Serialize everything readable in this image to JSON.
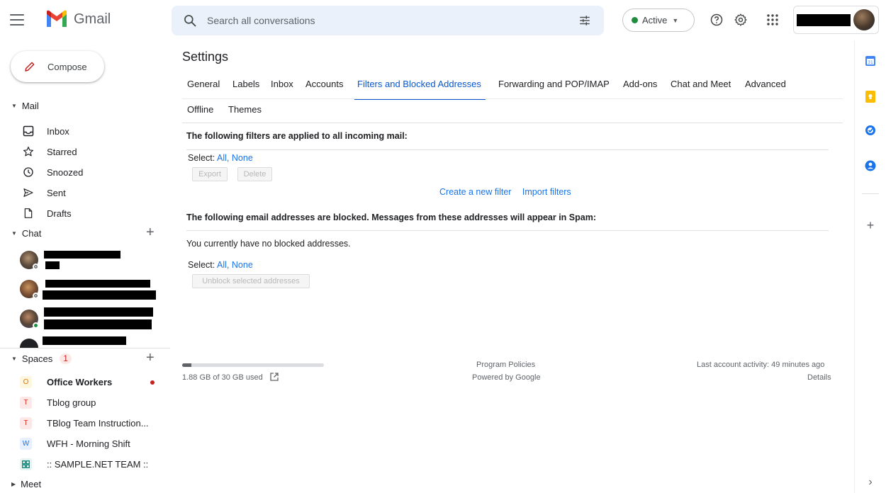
{
  "app": {
    "name": "Gmail"
  },
  "search": {
    "placeholder": "Search all conversations"
  },
  "status": {
    "label": "Active",
    "color": "#1e8e3e"
  },
  "compose": {
    "label": "Compose"
  },
  "sidebar": {
    "mail_title": "Mail",
    "mail_items": [
      {
        "label": "Inbox",
        "icon": "inbox-icon"
      },
      {
        "label": "Starred",
        "icon": "star-icon"
      },
      {
        "label": "Snoozed",
        "icon": "clock-icon"
      },
      {
        "label": "Sent",
        "icon": "send-icon"
      },
      {
        "label": "Drafts",
        "icon": "draft-icon"
      }
    ],
    "chat_title": "Chat",
    "spaces_title": "Spaces",
    "spaces_badge": "1",
    "spaces": [
      {
        "letter": "O",
        "label": "Office Workers",
        "unread": true
      },
      {
        "letter": "T",
        "label": "Tblog group"
      },
      {
        "letter": "T",
        "label": "TBlog Team Instruction..."
      },
      {
        "letter": "W",
        "label": "WFH - Morning Shift"
      },
      {
        "letter": "",
        "label": ":: SAMPLE.NET TEAM ::"
      }
    ],
    "meet_title": "Meet"
  },
  "settings": {
    "title": "Settings",
    "tabs": [
      {
        "label": "General"
      },
      {
        "label": "Labels"
      },
      {
        "label": "Inbox"
      },
      {
        "label": "Accounts"
      },
      {
        "label": "Filters and Blocked Addresses",
        "active": true
      },
      {
        "label": "Forwarding and POP/IMAP"
      },
      {
        "label": "Add-ons"
      },
      {
        "label": "Chat and Meet"
      },
      {
        "label": "Advanced"
      },
      {
        "label": "Offline"
      },
      {
        "label": "Themes"
      }
    ],
    "filters": {
      "heading": "The following filters are applied to all incoming mail:",
      "select_label": "Select:",
      "select_all": "All",
      "select_sep": ",",
      "select_none": "None",
      "export": "Export",
      "delete": "Delete",
      "create_filter": "Create a new filter",
      "import_filters": "Import filters"
    },
    "blocked": {
      "heading": "The following email addresses are blocked. Messages from these addresses will appear in Spam:",
      "empty": "You currently have no blocked addresses.",
      "select_label": "Select:",
      "select_all": "All",
      "select_sep": ",",
      "select_none": "None",
      "unblock": "Unblock selected addresses"
    }
  },
  "footer": {
    "storage": "1.88 GB of 30 GB used",
    "storage_fraction": 0.063,
    "program_policies": "Program Policies",
    "powered_by": "Powered by Google",
    "last_activity": "Last account activity: 49 minutes ago",
    "details": "Details"
  }
}
